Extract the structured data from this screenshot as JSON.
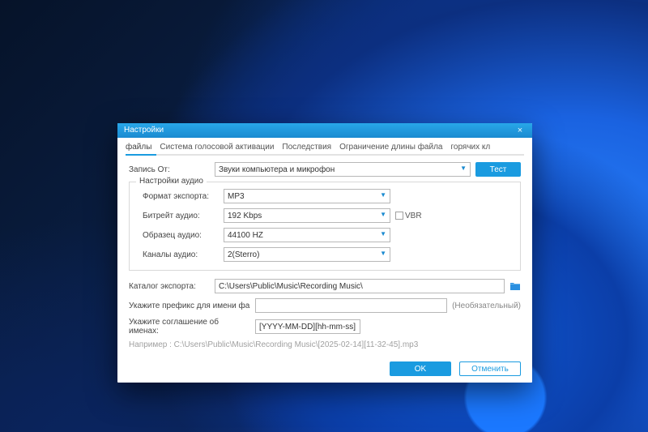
{
  "window": {
    "title": "Настройки",
    "close_glyph": "×"
  },
  "tabs": {
    "items": [
      {
        "label": "файлы"
      },
      {
        "label": "Система голосовой активации"
      },
      {
        "label": "Последствия"
      },
      {
        "label": "Ограничение длины файла"
      },
      {
        "label": "горячих кл"
      }
    ]
  },
  "record_from": {
    "label": "Запись От:",
    "value": "Звуки компьютера и микрофон",
    "test_button": "Тест"
  },
  "audio_settings": {
    "legend": "Настройки аудио",
    "export_format": {
      "label": "Формат экспорта:",
      "value": "MP3"
    },
    "bitrate": {
      "label": "Битрейт аудио:",
      "value": "192 Kbps"
    },
    "sample": {
      "label": "Образец аудио:",
      "value": "44100 HZ"
    },
    "channels": {
      "label": "Каналы аудио:",
      "value": "2(Sterro)"
    },
    "vbr_label": "VBR"
  },
  "export": {
    "catalog_label": "Каталог экспорта:",
    "catalog_value": "C:\\Users\\Public\\Music\\Recording Music\\",
    "prefix_label": "Укажите префикс для имени фа",
    "prefix_value": "",
    "optional_label": "(Необязательный)",
    "naming_label": "Укажите соглашение об именах:",
    "naming_value": "[YYYY-MM-DD][hh-mm-ss]",
    "example": "Например : C:\\Users\\Public\\Music\\Recording Music\\[2025-02-14][11-32-45].mp3"
  },
  "buttons": {
    "ok": "OK",
    "cancel": "Отменить"
  }
}
